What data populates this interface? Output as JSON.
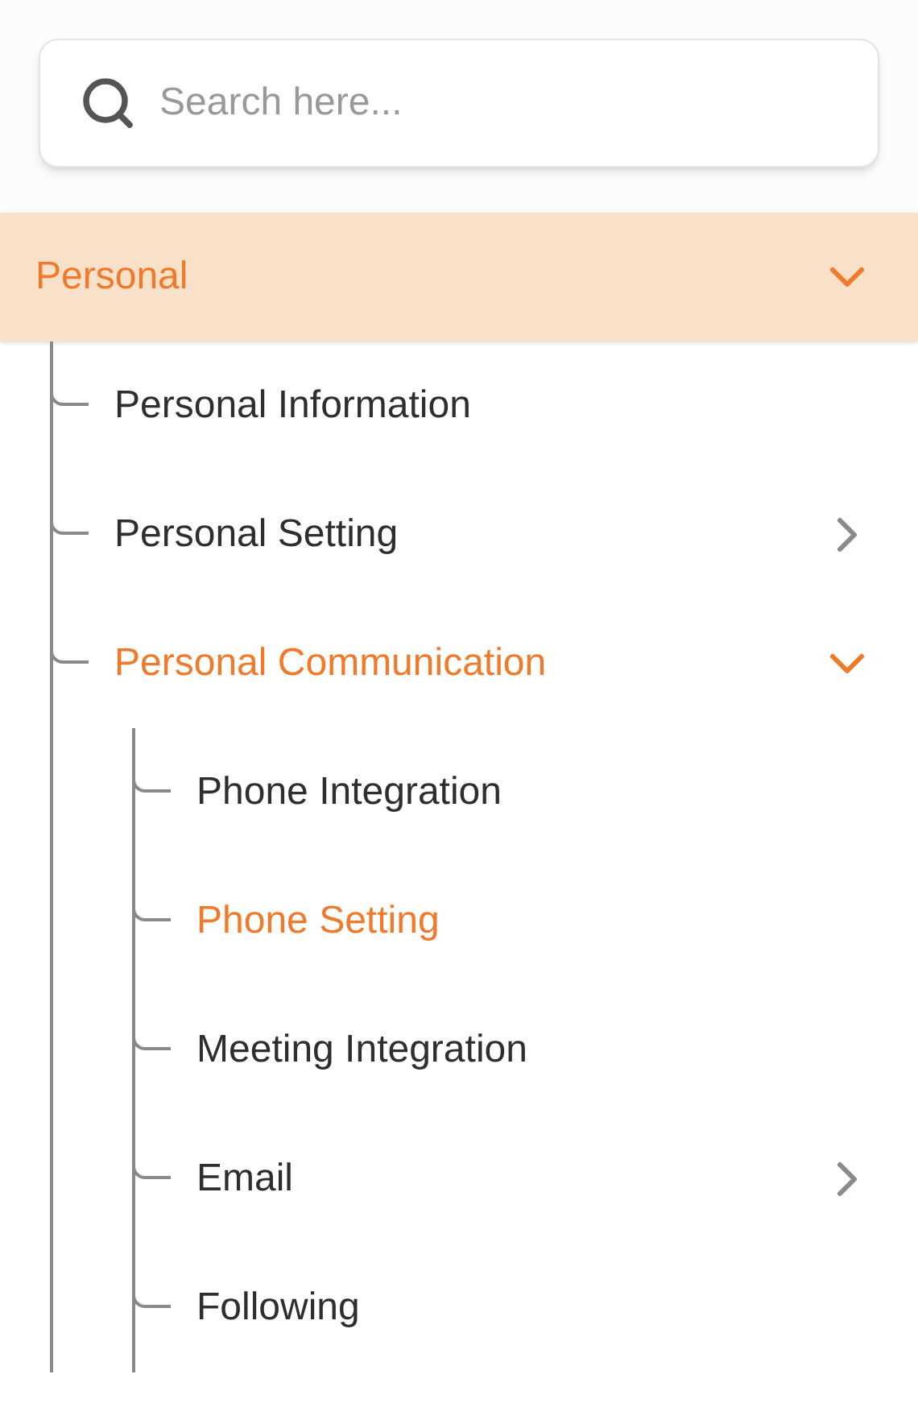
{
  "search": {
    "placeholder": "Search here..."
  },
  "menu": [
    {
      "label": "Personal",
      "expanded": true,
      "children": [
        {
          "label": "Personal Information",
          "selected": false
        },
        {
          "label": "Personal Setting",
          "expanded": false,
          "selected": false
        },
        {
          "label": "Personal Communication",
          "expanded": true,
          "selected": false,
          "children": [
            {
              "label": "Phone Integration",
              "selected": false
            },
            {
              "label": "Phone Setting",
              "selected": true
            },
            {
              "label": "Meeting Integration",
              "selected": false
            },
            {
              "label": "Email",
              "expanded": false,
              "selected": false
            },
            {
              "label": "Following",
              "selected": false
            }
          ]
        }
      ]
    }
  ]
}
